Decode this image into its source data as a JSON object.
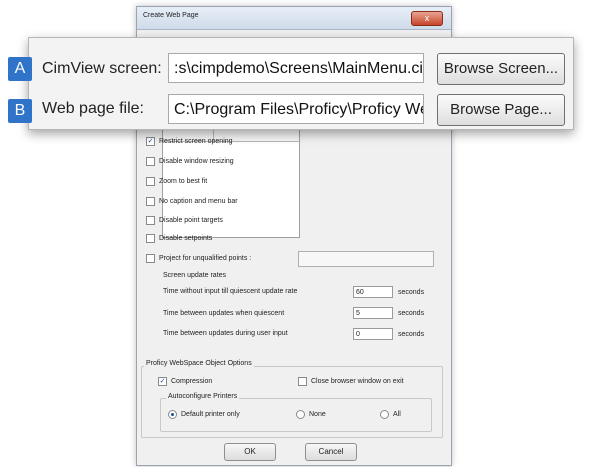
{
  "window": {
    "title": "Create Web Page",
    "close_glyph": "x"
  },
  "zoom": {
    "rows": [
      {
        "badge": "A",
        "label": "CimView screen:",
        "value": ":s\\cimpdemo\\Screens\\MainMenu.cim",
        "button": "Browse Screen..."
      },
      {
        "badge": "B",
        "label": "Web page file:",
        "value": "C:\\Program Files\\Proficy\\Proficy Web",
        "button": "Browse Page..."
      }
    ],
    "badge_color": "#2f74c8"
  },
  "options": [
    {
      "label": "Restrict screen opening",
      "checked": true
    },
    {
      "label": "Disable window resizing",
      "checked": false
    },
    {
      "label": "Zoom to best fit",
      "checked": false
    },
    {
      "label": "No caption and menu bar",
      "checked": false
    },
    {
      "label": "Disable point targets",
      "checked": false
    },
    {
      "label": "Disable setpoints",
      "checked": false
    },
    {
      "label": "Project for unqualified points :",
      "checked": false
    }
  ],
  "update_rates": {
    "title": "Screen update rates",
    "rows": [
      {
        "label": "Time without input till quiescent update rate",
        "value": "60",
        "unit": "seconds"
      },
      {
        "label": "Time between updates when quiescent",
        "value": "5",
        "unit": "seconds"
      },
      {
        "label": "Time between updates during user input",
        "value": "0",
        "unit": "seconds"
      }
    ]
  },
  "webspace": {
    "title": "Proficy WebSpace Object Options",
    "compression": {
      "label": "Compression",
      "checked": true
    },
    "close_browser": {
      "label": "Close browser window on exit",
      "checked": false
    },
    "printers": {
      "title": "Autoconfigure Printers",
      "options": [
        {
          "label": "Default printer only",
          "selected": true
        },
        {
          "label": "None",
          "selected": false
        },
        {
          "label": "All",
          "selected": false
        }
      ]
    }
  },
  "buttons": {
    "ok": "OK",
    "cancel": "Cancel"
  },
  "check_glyph": "✓"
}
